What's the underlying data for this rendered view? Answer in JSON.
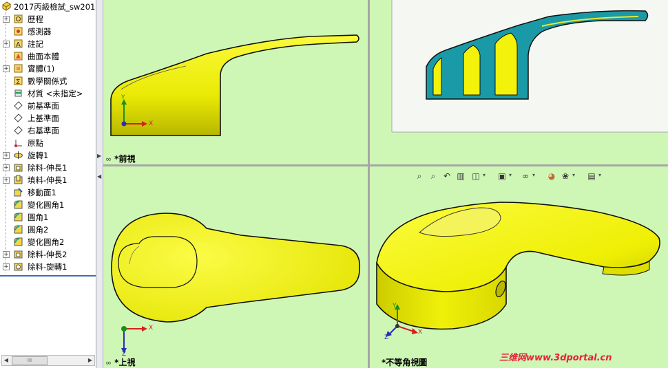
{
  "tree": {
    "root": "2017丙級檢試_sw201",
    "items": [
      {
        "label": "歷程",
        "icon": "history-icon",
        "expander": "+"
      },
      {
        "label": "感測器",
        "icon": "sensor-icon",
        "expander": ""
      },
      {
        "label": "註記",
        "icon": "annotation-icon",
        "expander": "+"
      },
      {
        "label": "曲面本體",
        "icon": "surface-body-icon",
        "expander": ""
      },
      {
        "label": "實體(1)",
        "icon": "solid-body-icon",
        "expander": "+"
      },
      {
        "label": "數學關係式",
        "icon": "equations-icon",
        "expander": ""
      },
      {
        "label": "材質 <未指定>",
        "icon": "material-icon",
        "expander": ""
      },
      {
        "label": "前基準面",
        "icon": "plane-icon",
        "expander": ""
      },
      {
        "label": "上基準面",
        "icon": "plane-icon",
        "expander": ""
      },
      {
        "label": "右基準面",
        "icon": "plane-icon",
        "expander": ""
      },
      {
        "label": "原點",
        "icon": "origin-icon",
        "expander": ""
      },
      {
        "label": "旋轉1",
        "icon": "revolve-icon",
        "expander": "+"
      },
      {
        "label": "除料-伸長1",
        "icon": "extrude-cut-icon",
        "expander": "+"
      },
      {
        "label": "填料-伸長1",
        "icon": "extrude-boss-icon",
        "expander": "+"
      },
      {
        "label": "移動面1",
        "icon": "move-face-icon",
        "expander": ""
      },
      {
        "label": "變化圓角1",
        "icon": "fillet-icon",
        "expander": ""
      },
      {
        "label": "圓角1",
        "icon": "fillet-icon",
        "expander": ""
      },
      {
        "label": "圓角2",
        "icon": "fillet-icon",
        "expander": ""
      },
      {
        "label": "變化圓角2",
        "icon": "fillet-icon",
        "expander": ""
      },
      {
        "label": "除料-伸長2",
        "icon": "extrude-cut-icon",
        "expander": "+"
      },
      {
        "label": "除料-旋轉1",
        "icon": "revolve-cut-icon",
        "expander": "+"
      }
    ]
  },
  "viewports": {
    "front": {
      "label": "*前視"
    },
    "top": {
      "label": "*上視"
    },
    "iso": {
      "label": "*不等角視圖"
    }
  },
  "axes": {
    "x": "X",
    "y": "Y",
    "z": "Z"
  },
  "watermark": {
    "brand": "三维网",
    "url": "www.3dportal.cn"
  },
  "colors": {
    "viewport_bg": "#cef7b5",
    "part": "#f2f20a",
    "section": "#1a9aa6",
    "accent": "#3b6fb0"
  }
}
